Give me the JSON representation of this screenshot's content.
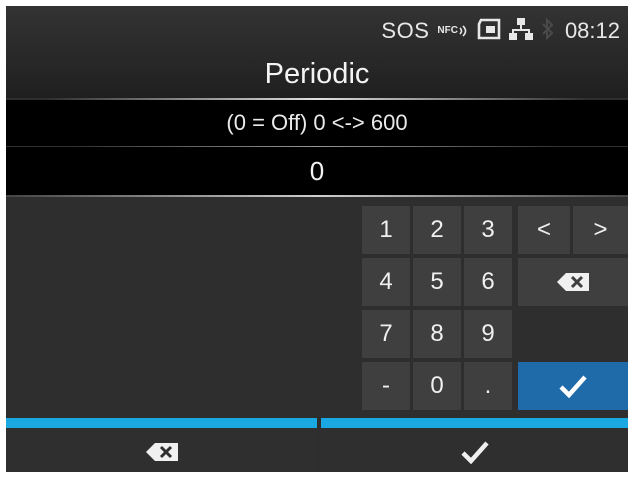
{
  "status": {
    "sos": "SOS",
    "nfc": "NFC",
    "time": "08:12",
    "icons": [
      "nfc-icon",
      "memory-card-icon",
      "network-icon",
      "bluetooth-icon"
    ]
  },
  "title": "Periodic",
  "range_text": "(0 = Off) 0 <-> 600",
  "value": "0",
  "keypad": {
    "keys": [
      "1",
      "2",
      "3",
      "<",
      ">",
      "4",
      "5",
      "6",
      "7",
      "8",
      "9",
      "-",
      "0",
      "."
    ],
    "icons": [
      "backspace-icon",
      "checkmark-icon"
    ],
    "ok_color": "#1f6aa8"
  },
  "bottom_bar": {
    "left_icon": "backspace-icon",
    "right_icon": "checkmark-icon",
    "accent_color": "#1aa8e2"
  }
}
